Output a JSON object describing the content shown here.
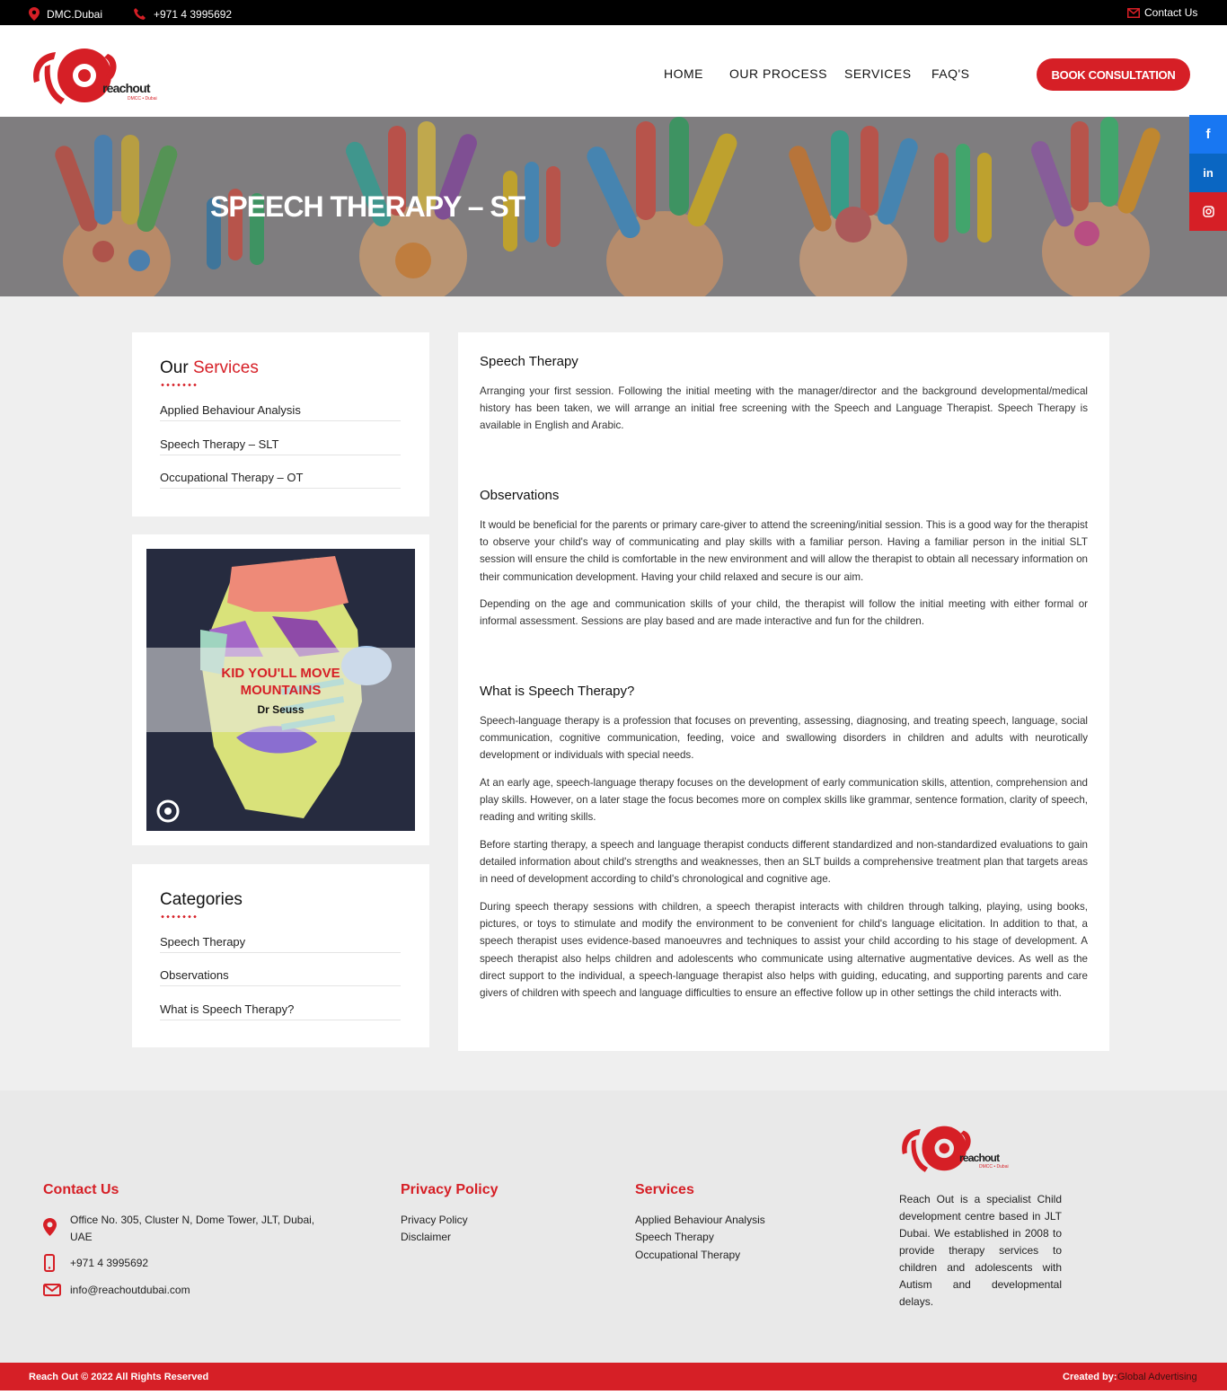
{
  "topbar": {
    "location": "DMC.Dubai",
    "phone": "+971 4 3995692",
    "contact": "Contact Us"
  },
  "header": {
    "logo_text": "reachout",
    "logo_sub": "DMCC • Dubai",
    "nav": [
      "HOME",
      "OUR PROCESS",
      "SERVICES",
      "FAQ'S"
    ],
    "book_label": "BOOK CONSULTATION"
  },
  "hero": {
    "title": "SPEECH THERAPY – ST"
  },
  "social": {
    "facebook": "f",
    "linkedin": "in",
    "instagram_icon": "instagram-icon",
    "colors": {
      "facebook": "#1877f2",
      "linkedin": "#0a66c2",
      "instagram": "#d61f26"
    }
  },
  "sidebar": {
    "services_title_a": "Our",
    "services_title_b": "Services",
    "services": [
      "Applied Behaviour Analysis",
      "Speech Therapy – SLT",
      "Occupational Therapy – OT"
    ],
    "poster_line1": "KID YOU'LL MOVE",
    "poster_line2": "MOUNTAINS",
    "poster_author": "Dr Seuss",
    "categories_title": "Categories",
    "categories": [
      "Speech Therapy",
      "Observations",
      "What is Speech Therapy?"
    ]
  },
  "content": {
    "sections": [
      {
        "heading": "Speech Therapy",
        "paragraphs": [
          "Arranging your first session.  Following the initial meeting with the manager/director and the background developmental/medical history has been taken, we will arrange an initial free screening with the Speech and Language Therapist. Speech Therapy is available in English and Arabic."
        ]
      },
      {
        "heading": "Observations",
        "paragraphs": [
          "It would be beneficial for the parents or primary care-giver to attend the screening/initial session. This is a good way for the therapist to observe your child's way of communicating and play skills with a familiar person.  Having a familiar person in the initial SLT session will ensure the child is comfortable in the new environment and will allow the therapist to obtain all necessary information on their communication development. Having your child relaxed and secure is our aim.",
          "Depending on the age and communication skills of your child, the therapist will follow the initial meeting with either formal or informal assessment. Sessions are play based and are made interactive and fun for the children."
        ]
      },
      {
        "heading": "What is Speech Therapy?",
        "paragraphs": [
          "Speech-language therapy is a profession that focuses on preventing, assessing, diagnosing, and treating speech, language, social communication, cognitive communication, feeding, voice and swallowing disorders in children and adults with neurotically development or individuals with special needs.",
          "At an early age, speech-language therapy focuses on the development of early communication skills, attention, comprehension and play skills. However, on a later stage the focus becomes more on complex skills like grammar, sentence formation, clarity of speech, reading and writing skills.",
          "Before starting therapy, a speech and language therapist conducts different standardized and non-standardized evaluations to gain detailed information about child's strengths and weaknesses, then an SLT builds a comprehensive treatment plan that targets areas in need of development according to child's chronological and cognitive age.",
          "During speech therapy sessions with children, a speech therapist interacts with children through talking, playing, using books, pictures, or toys to stimulate and modify the environment to be convenient for child's language elicitation. In addition to that, a speech therapist uses evidence-based manoeuvres and techniques to assist your child according to his stage of development. A speech therapist also helps children and adolescents who communicate using alternative augmentative devices. As well as the direct support to the individual, a speech-language therapist also helps with guiding, educating, and supporting parents and care givers of children with speech and language difficulties to ensure an effective follow up in other settings the child interacts with."
        ]
      }
    ]
  },
  "footer": {
    "contact_title": "Contact Us",
    "address_line1": "Office No. 305, Cluster N, Dome Tower, JLT, Dubai,",
    "address_line2": "UAE",
    "phone": "+971 4 3995692",
    "email": "info@reachoutdubai.com",
    "privacy_title": "Privacy Policy",
    "privacy_links": [
      "Privacy Policy",
      "Disclaimer"
    ],
    "services_title": "Services",
    "services_links": [
      "Applied Behaviour Analysis",
      "Speech Therapy",
      "Occupational Therapy"
    ],
    "about": "Reach Out is a specialist Child development centre based in JLT Dubai. We established in 2008 to provide therapy services to children and adolescents with Autism and developmental delays."
  },
  "bottombar": {
    "copyright": "Reach Out © 2022  All Rights Reserved",
    "created_label": "Created by:",
    "created_by": "Global Advertising"
  },
  "colors": {
    "brand_red": "#d61f26",
    "black": "#000000"
  }
}
